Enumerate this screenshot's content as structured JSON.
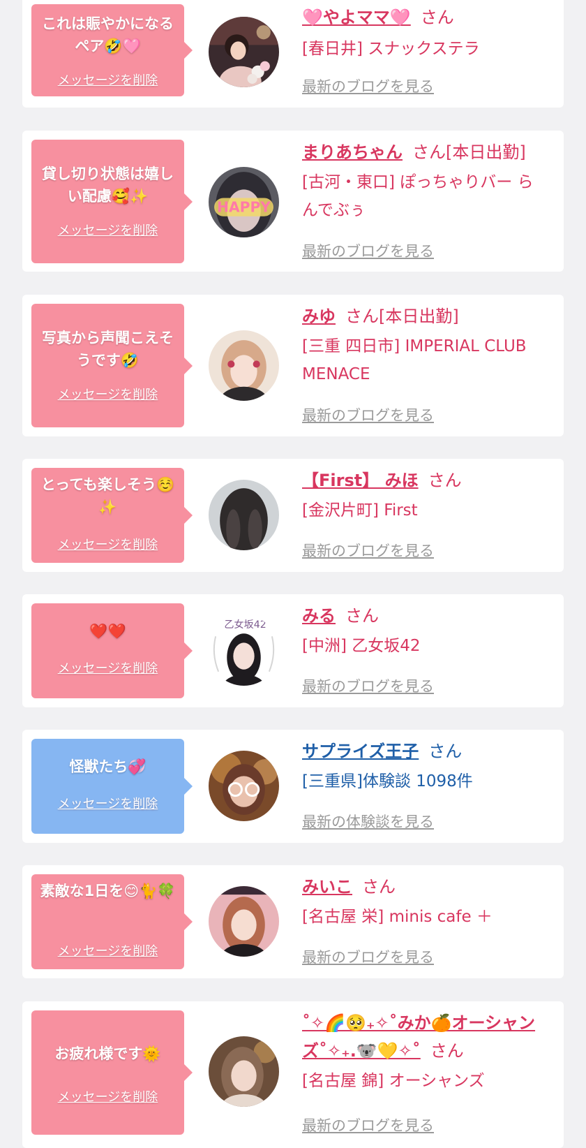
{
  "entries": [
    {
      "message": "これは賑やかになるペア🤣🩷",
      "delete_label": "メッセージを削除",
      "name": "🩷やよママ🩷",
      "honorific": "さん",
      "shop": "[春日井] スナックステラ",
      "link": "最新のブログを見る"
    },
    {
      "message": "貸し切り状態は嬉しい配慮🥰✨",
      "delete_label": "メッセージを削除",
      "name": "まりあちゃん",
      "honorific": "さん[本日出勤]",
      "shop": "[古河・東口] ぽっちゃりバー らんでぶぅ",
      "link": "最新のブログを見る",
      "avatar_text": "HAPPY"
    },
    {
      "message": "写真から声聞こえそうです🤣",
      "delete_label": "メッセージを削除",
      "name": "みゆ",
      "honorific": "さん[本日出勤]",
      "shop": "[三重 四日市] IMPERIAL CLUB MENACE",
      "link": "最新のブログを見る"
    },
    {
      "message": "とっても楽しそう☺️✨",
      "delete_label": "メッセージを削除",
      "name": "【First】 みほ",
      "honorific": "さん",
      "shop": "[金沢片町] First",
      "link": "最新のブログを見る"
    },
    {
      "message": "❤️❤️",
      "delete_label": "メッセージを削除",
      "name": "みる",
      "honorific": "さん",
      "shop": "[中洲] 乙女坂42",
      "link": "最新のブログを見る",
      "avatar_text": "乙女坂42"
    },
    {
      "message": "怪獣たち💞",
      "delete_label": "メッセージを削除",
      "name": "サプライズ王子",
      "honorific": "さん",
      "shop": "[三重県]体験談 1098件",
      "link": "最新の体験談を見る",
      "type": "male"
    },
    {
      "message": "素敵な1日を😊🐈🍀",
      "delete_label": "メッセージを削除",
      "name": "みいこ",
      "honorific": "さん",
      "shop": "[名古屋 栄] minis cafe ＋",
      "link": "最新のブログを見る"
    },
    {
      "message": "お疲れ様です🌞",
      "delete_label": "メッセージを削除",
      "name": "˚✧🌈🥺₊✧˚みか🍊オーシャンズ˚✧₊.🐨💛✧˚",
      "honorific": "さん",
      "shop": "[名古屋 錦] オーシャンズ",
      "link": "最新のブログを見る"
    }
  ],
  "colors": {
    "background": "#f1f1f3",
    "card": "#ffffff",
    "bubble_pink": "#f7909f",
    "bubble_blue": "#86b6f2",
    "name_pink": "#d8365f",
    "name_blue": "#1f5fa8",
    "link_gray": "#9a9a9a"
  }
}
